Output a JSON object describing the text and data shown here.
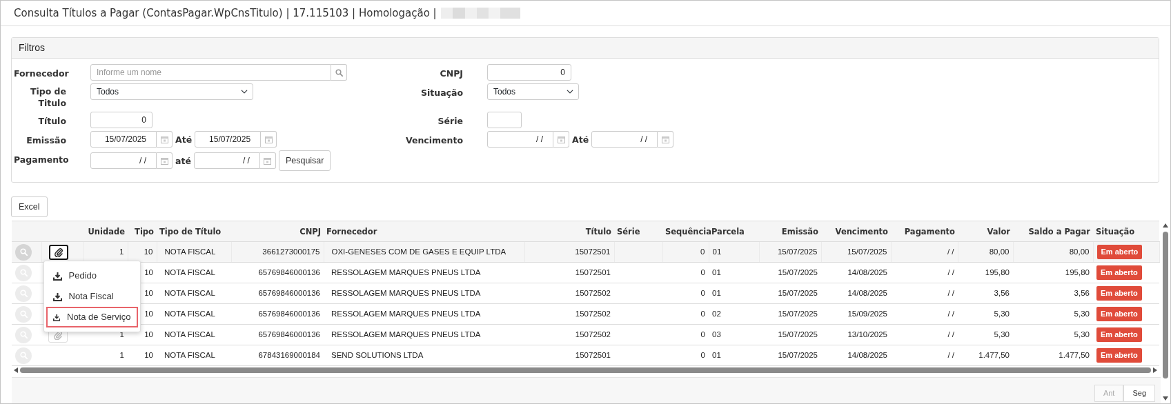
{
  "window": {
    "title": "Consulta Títulos a Pagar (ContasPagar.WpCnsTitulo) | 17.115103 | Homologação |"
  },
  "filters": {
    "title": "Filtros",
    "left": [
      {
        "label": "Fornecedor",
        "kind": "search",
        "placeholder": "Informe um nome"
      },
      {
        "label": "Tipo de Titulo",
        "kind": "select",
        "value": "Todos"
      },
      {
        "label": "Título",
        "kind": "number",
        "value": "0"
      },
      {
        "label": "Emissão",
        "kind": "date_range",
        "from": "15/07/2025",
        "to_label": "Até",
        "to": "15/07/2025"
      },
      {
        "label": "Pagamento",
        "kind": "date_range",
        "from": "/ /",
        "to_label": "até",
        "to": "/ /",
        "button": "Pesquisar"
      }
    ],
    "right": [
      {
        "label": "CNPJ",
        "kind": "number",
        "value": "0"
      },
      {
        "label": "Situação",
        "kind": "select",
        "value": "Todos"
      },
      {
        "label": "Série",
        "kind": "short"
      },
      {
        "label": "Vencimento",
        "kind": "date_range",
        "from": "/ /",
        "to_label": "Até",
        "to": "/ /"
      }
    ]
  },
  "excel_button": "Excel",
  "table": {
    "columns": [
      "Unidade",
      "Tipo",
      "Tipo de Título",
      "CNPJ",
      "Fornecedor",
      "Título",
      "Série",
      "Sequência",
      "Parcela",
      "Emissão",
      "Vencimento",
      "Pagamento",
      "Valor",
      "Saldo a Pagar",
      "Situação"
    ],
    "rows": [
      {
        "hovered": true,
        "attachment": true,
        "menu_open": true,
        "unidade": "1",
        "tipo": "10",
        "tipo_titulo": "NOTA FISCAL",
        "cnpj": "3661273000175",
        "fornecedor": "OXI-GENESES COM DE GASES E EQUIP LTDA",
        "titulo": "15072501",
        "sequencia": "0",
        "parcela": "01",
        "emissao": "15/07/2025",
        "vencimento": "15/07/2025",
        "pagamento": "/ /",
        "valor": "80,00",
        "saldo": "80,00",
        "situacao": "Em aberto"
      },
      {
        "hovered": false,
        "tipo": "10",
        "tipo_titulo": "NOTA FISCAL",
        "cnpj": "65769846000136",
        "fornecedor": "RESSOLAGEM MARQUES PNEUS LTDA",
        "titulo": "15072501",
        "sequencia": "0",
        "parcela": "01",
        "emissao": "15/07/2025",
        "vencimento": "14/08/2025",
        "pagamento": "/ /",
        "valor": "195,80",
        "saldo": "195,80",
        "situacao": "Em aberto"
      },
      {
        "hovered": false,
        "tipo": "10",
        "tipo_titulo": "NOTA FISCAL",
        "cnpj": "65769846000136",
        "fornecedor": "RESSOLAGEM MARQUES PNEUS LTDA",
        "titulo": "15072502",
        "sequencia": "0",
        "parcela": "01",
        "emissao": "15/07/2025",
        "vencimento": "14/08/2025",
        "pagamento": "/ /",
        "valor": "3,56",
        "saldo": "3,56",
        "situacao": "Em aberto"
      },
      {
        "hovered": false,
        "tipo": "10",
        "tipo_titulo": "NOTA FISCAL",
        "cnpj": "65769846000136",
        "fornecedor": "RESSOLAGEM MARQUES PNEUS LTDA",
        "titulo": "15072502",
        "sequencia": "0",
        "parcela": "02",
        "emissao": "15/07/2025",
        "vencimento": "15/09/2025",
        "pagamento": "/ /",
        "valor": "5,30",
        "saldo": "5,30",
        "situacao": "Em aberto"
      },
      {
        "hovered": false,
        "attachment": true,
        "menu_open": false,
        "unidade": "1",
        "tipo": "10",
        "tipo_titulo": "NOTA FISCAL",
        "cnpj": "65769846000136",
        "fornecedor": "RESSOLAGEM MARQUES PNEUS LTDA",
        "titulo": "15072502",
        "sequencia": "0",
        "parcela": "03",
        "emissao": "15/07/2025",
        "vencimento": "13/10/2025",
        "pagamento": "/ /",
        "valor": "5,30",
        "saldo": "5,30",
        "situacao": "Em aberto"
      },
      {
        "hovered": false,
        "attachment": false,
        "unidade": "1",
        "tipo": "10",
        "tipo_titulo": "NOTA FISCAL",
        "cnpj": "67843169000184",
        "fornecedor": "SEND SOLUTIONS LTDA",
        "titulo": "15072501",
        "sequencia": "0",
        "parcela": "01",
        "emissao": "15/07/2025",
        "vencimento": "14/08/2025",
        "pagamento": "/ /",
        "valor": "1.477,50",
        "saldo": "1.477,50",
        "situacao": "Em aberto"
      }
    ]
  },
  "attachment_menu": {
    "items": [
      {
        "label": "Pedido",
        "selected": false
      },
      {
        "label": "Nota Fiscal",
        "selected": false
      },
      {
        "label": "Nota de Serviço",
        "selected": true
      }
    ]
  },
  "pager": [
    {
      "label": "Ant",
      "disabled": true
    },
    {
      "label": "Seg",
      "disabled": false
    }
  ]
}
